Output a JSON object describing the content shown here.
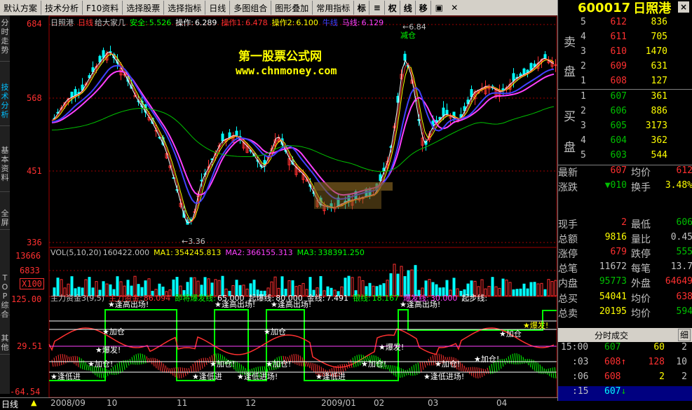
{
  "menu": [
    "默认方案",
    "技术分析",
    "F10资料",
    "选择股票",
    "选择指标",
    "日线",
    "多图组合",
    "图形叠加",
    "常用指标"
  ],
  "toolbar": [
    "标",
    "≡",
    "权",
    "线",
    "移"
  ],
  "left_tabs": [
    "分时走势",
    "技术分析",
    "基本资料",
    "全屏",
    "TOP综合",
    "其他"
  ],
  "ticker": {
    "code": "600017",
    "name": "日照港",
    "close": "×"
  },
  "price_axis": [
    "684",
    "568",
    "451",
    "336"
  ],
  "vol_axis": [
    "13666",
    "6833",
    "X100"
  ],
  "ind_axis": [
    "125.00",
    "29.51",
    "-64.54"
  ],
  "main_header": {
    "name": "日照港",
    "period": "日线",
    "sub": "给大家几",
    "s1k": "安全:",
    "s1v": "5.526",
    "s2k": "操作:",
    "s2v": "6.289",
    "s3k": "操作1:",
    "s3v": "6.478",
    "s4k": "操作2:",
    "s4v": "6.100",
    "s5k": "牛线",
    "s6k": "马线:",
    "s6v": "6.129"
  },
  "vol_header": {
    "t": "VOL(5,10,20)",
    "v": "160422.000",
    "ma1k": "MA1:",
    "ma1": "354245.813",
    "ma2k": "MA2:",
    "ma2": "366155.313",
    "ma3k": "MA3:",
    "ma3": "338391.250"
  },
  "ind_header": {
    "t": "主力资金3(9,5)",
    "a": "主力资金:",
    "av": "86.094",
    "b": "即将爆发线:",
    "bv": "65.000",
    "c": "起爆线:",
    "cv": "80.000",
    "d": "金线:",
    "dv": "7.491",
    "e": "银线:",
    "ev": "18.167",
    "f": "爆发线:",
    "fv": "30.000",
    "g": "起步线:"
  },
  "watermark": {
    "line1": "第一股票公式网",
    "line2": "www.chnmoney.com"
  },
  "price_notes": {
    "low": "3.36",
    "high": "6.84",
    "hold": "减仓"
  },
  "ind_labels": {
    "top": "★逢高出场!",
    "add": "★加仓",
    "add2": "★加仓!",
    "burst": "★爆发!",
    "burst2": "★爆发!",
    "bottom": "★逢低进场!",
    "bottom_short": "★逢低进",
    "burst_y": "★爆发!"
  },
  "sell_rows": [
    {
      "lvl": "5",
      "price": "612",
      "vol": "836"
    },
    {
      "lvl": "4",
      "price": "611",
      "vol": "705"
    },
    {
      "lvl": "3",
      "price": "610",
      "vol": "1470"
    },
    {
      "lvl": "2",
      "price": "609",
      "vol": "631"
    },
    {
      "lvl": "1",
      "price": "608",
      "vol": "127"
    }
  ],
  "buy_rows": [
    {
      "lvl": "1",
      "price": "607",
      "vol": "361"
    },
    {
      "lvl": "2",
      "price": "606",
      "vol": "886"
    },
    {
      "lvl": "3",
      "price": "605",
      "vol": "3173"
    },
    {
      "lvl": "4",
      "price": "604",
      "vol": "362"
    },
    {
      "lvl": "5",
      "price": "603",
      "vol": "544"
    }
  ],
  "sell_head": [
    "卖",
    "盘"
  ],
  "buy_head": [
    "买",
    "盘"
  ],
  "quote": [
    {
      "k1": "最新",
      "v1": "607",
      "k2": "均价",
      "v2": "612"
    },
    {
      "k1": "涨跌",
      "v1": "▼010",
      "k2": "换手",
      "v2": "3.48%"
    },
    {
      "k1": "现手",
      "v1": "2",
      "k2": "最低",
      "v2": "606"
    },
    {
      "k1": "总额",
      "v1": "9816",
      "k2": "量比",
      "v2": "0.45"
    },
    {
      "k1": "涨停",
      "v1": "679",
      "k2": "跌停",
      "v2": "555"
    },
    {
      "k1": "总笔",
      "v1": "11672",
      "k2": "每笔",
      "v2": "13.7"
    },
    {
      "k1": "内盘",
      "v1": "95773",
      "k2": "外盘",
      "v2": "64649"
    },
    {
      "k1": "总买",
      "v1": "54041",
      "k2": "均价",
      "v2": "638"
    },
    {
      "k1": "总卖",
      "v1": "20195",
      "k2": "均价",
      "v2": "594"
    }
  ],
  "fs_title": {
    "label": "分时成交",
    "btn": "细"
  },
  "ticks": [
    {
      "t": "15:00",
      "p": "607",
      "v": "60",
      "n": "2"
    },
    {
      "t": ":03",
      "p": "608",
      "v": "128",
      "n": "10"
    },
    {
      "t": ":06",
      "p": "608",
      "v": "2",
      "n": "2"
    },
    {
      "t": ":15",
      "p": "607",
      "v": "",
      "n": ""
    }
  ],
  "dates": [
    {
      "label": "2008/09"
    },
    {
      "label": "10"
    },
    {
      "label": "11"
    },
    {
      "label": "12"
    },
    {
      "label": "2009/01"
    },
    {
      "label": "02"
    },
    {
      "label": "03"
    },
    {
      "label": "04"
    }
  ],
  "bottom_tab": "日线",
  "colors": {
    "up": "#ff3030",
    "down": "#00ffff",
    "ma_white": "#ffffff",
    "ma_yellow": "#ffff00",
    "ma_magenta": "#ff40ff",
    "ma_blue": "#4040ff",
    "ma_green": "#00c000",
    "ind_green": "#00ff00"
  }
}
